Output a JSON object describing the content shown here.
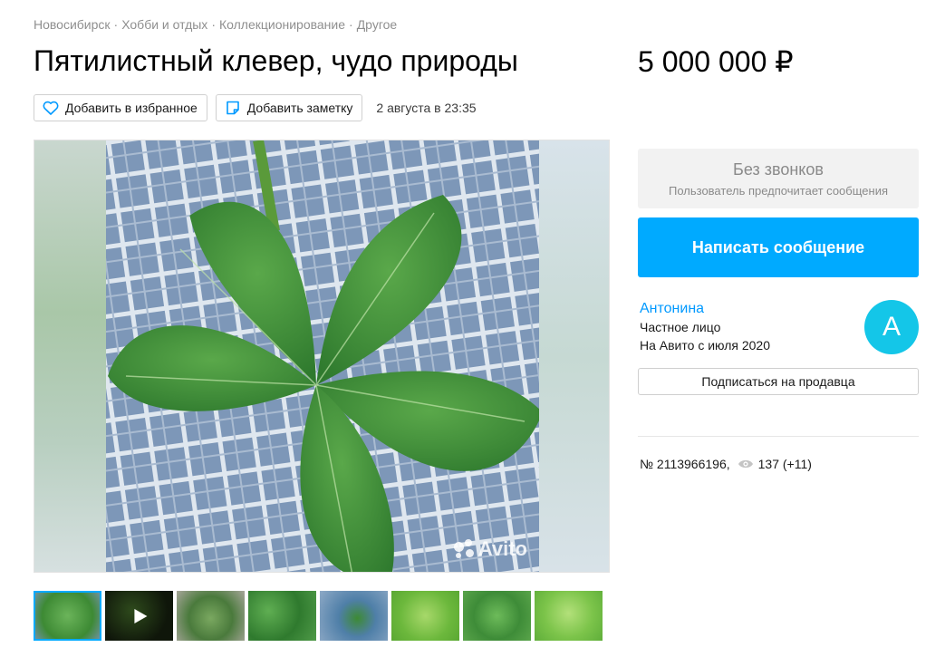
{
  "breadcrumb": [
    "Новосибирск",
    "Хобби и отдых",
    "Коллекционирование",
    "Другое"
  ],
  "title": "Пятилистный клевер, чудо природы",
  "price": "5 000 000 ₽",
  "actions": {
    "favorite_label": "Добавить в избранное",
    "note_label": "Добавить заметку",
    "date": "2 августа в 23:35"
  },
  "gallery": {
    "watermark": "Avito",
    "thumbnails": [
      {
        "kind": "photo",
        "active": true
      },
      {
        "kind": "video",
        "active": false
      },
      {
        "kind": "photo",
        "active": false
      },
      {
        "kind": "photo",
        "active": false
      },
      {
        "kind": "photo",
        "active": false
      },
      {
        "kind": "photo",
        "active": false
      },
      {
        "kind": "photo",
        "active": false
      },
      {
        "kind": "photo",
        "active": false
      }
    ]
  },
  "contact": {
    "no_calls_title": "Без звонков",
    "no_calls_subtitle": "Пользователь предпочитает сообщения",
    "message_button": "Написать сообщение"
  },
  "seller": {
    "name": "Антонина",
    "type": "Частное лицо",
    "since": "На Авито с июля 2020",
    "avatar_letter": "А",
    "subscribe_button": "Подписаться на продавца"
  },
  "item_meta": {
    "number": "№ 2113966196,",
    "views": "137 (+11)"
  },
  "colors": {
    "accent": "#00aaff",
    "link": "#0099ff",
    "avatar": "#14c6e8",
    "muted_text": "#8f8f8f"
  },
  "icons": [
    "heart-icon",
    "note-icon",
    "eye-icon",
    "play-icon",
    "avito-logo"
  ]
}
